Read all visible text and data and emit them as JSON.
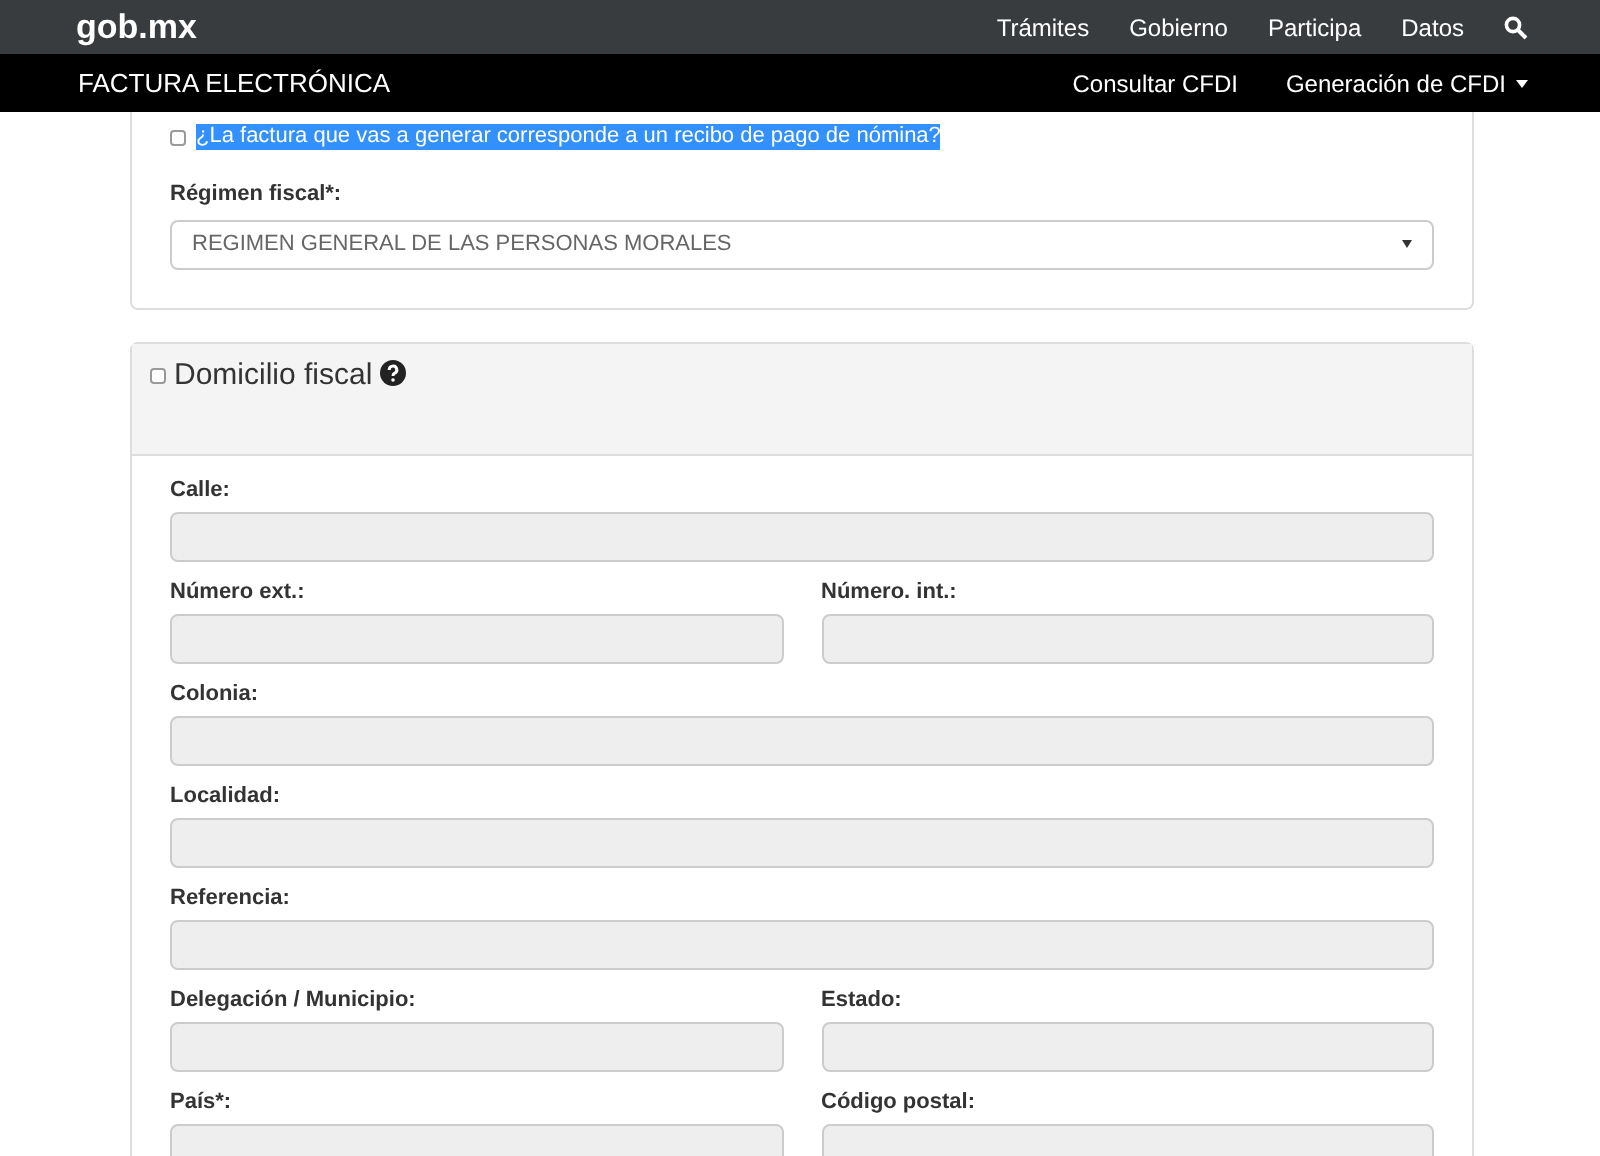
{
  "top_nav": {
    "logo": "gob.mx",
    "links": [
      "Trámites",
      "Gobierno",
      "Participa",
      "Datos"
    ]
  },
  "sub_nav": {
    "title": "FACTURA ELECTRÓNICA",
    "links": [
      {
        "label": "Consultar CFDI",
        "dropdown": false
      },
      {
        "label": "Generación de CFDI",
        "dropdown": true
      }
    ]
  },
  "payroll_question": {
    "label": "¿La factura que vas a generar corresponde a un recibo de pago de nómina?",
    "checked": false,
    "highlighted": true
  },
  "tax_regime": {
    "label": "Régimen fiscal*:",
    "value": "REGIMEN GENERAL DE LAS PERSONAS MORALES"
  },
  "fiscal_address": {
    "title": "Domicilio fiscal",
    "checked": false,
    "rows": [
      [
        {
          "label": "Calle:",
          "disabled": true
        }
      ],
      [
        {
          "label": "Número ext.:",
          "disabled": true
        },
        {
          "label": "Número. int.:",
          "disabled": true
        }
      ],
      [
        {
          "label": "Colonia:",
          "disabled": true
        }
      ],
      [
        {
          "label": "Localidad:",
          "disabled": true
        }
      ],
      [
        {
          "label": "Referencia:",
          "disabled": true
        }
      ],
      [
        {
          "label": "Delegación / Municipio:",
          "disabled": true
        },
        {
          "label": "Estado:",
          "disabled": true
        }
      ],
      [
        {
          "label": "País*:",
          "disabled": true
        },
        {
          "label": "Código postal:",
          "disabled": true
        }
      ]
    ]
  }
}
